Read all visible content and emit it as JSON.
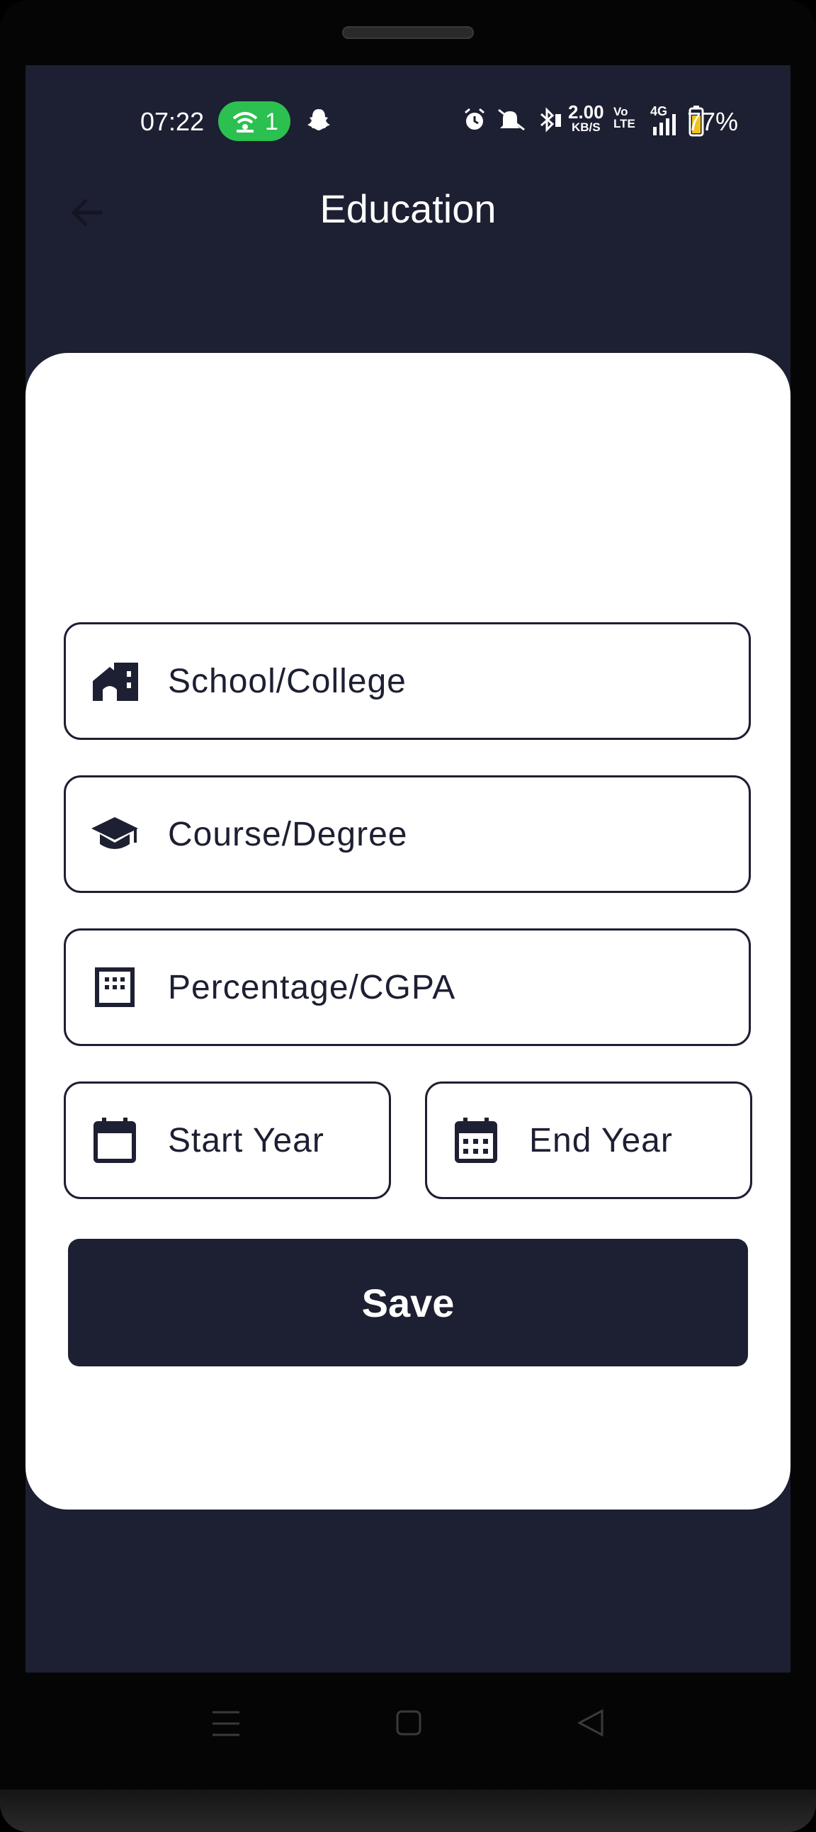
{
  "status_bar": {
    "time": "07:22",
    "wifi_count": "1",
    "speed_value": "2.00",
    "speed_unit": "KB/S",
    "volte_top": "Vo",
    "volte_bottom": "LTE",
    "network": "4G",
    "battery": "77%"
  },
  "header": {
    "title": "Education"
  },
  "form": {
    "school_placeholder": "School/College",
    "course_placeholder": "Course/Degree",
    "percentage_placeholder": "Percentage/CGPA",
    "start_year_placeholder": "Start Year",
    "end_year_placeholder": "End Year",
    "save_label": "Save"
  },
  "icons": {
    "school": "school-icon",
    "course": "graduation-cap-icon",
    "percentage": "grid-icon",
    "start_year": "calendar-icon",
    "end_year": "calendar-month-icon"
  },
  "colors": {
    "primary": "#1d1f32",
    "card": "#ffffff",
    "wifi_pill": "#2bc04f"
  }
}
